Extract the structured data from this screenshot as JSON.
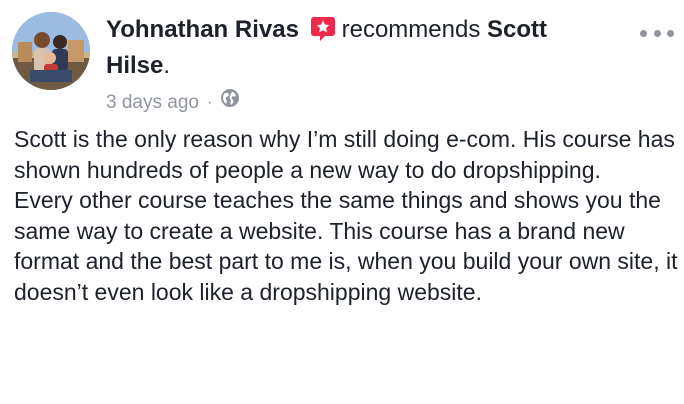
{
  "post": {
    "author": "Yohnathan Rivas",
    "action": "recommends",
    "target_first": "Scott",
    "target_last": "Hilse",
    "target_suffix": ".",
    "timestamp": "3 days ago",
    "separator": "·",
    "privacy_icon": "globe-icon",
    "recommend_icon": "star-badge-icon",
    "more_icon": "ellipsis-icon",
    "paragraphs": [
      "Scott is the only reason why I’m still doing e-com. His course has shown hundreds of people a new way to do dropshipping.",
      "Every other course teaches the same things and shows you the same way to create a website. This course has a brand new format and the best part to me is, when you build your own site, it doesn’t even look like a dropshipping website."
    ]
  },
  "colors": {
    "recommend_red": "#f02849",
    "meta_gray": "#90949c",
    "text": "#1d2129"
  }
}
